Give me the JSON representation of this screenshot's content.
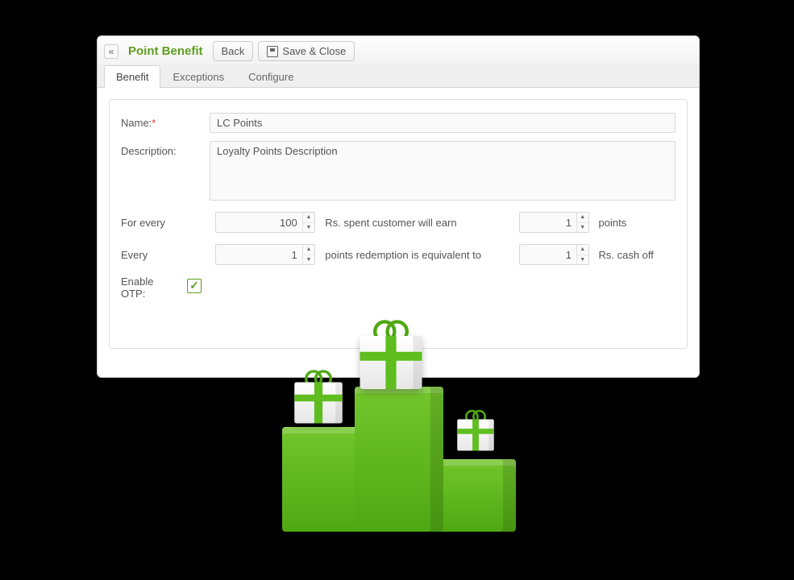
{
  "header": {
    "title": "Point Benefit",
    "back_label": "Back",
    "save_label": "Save & Close"
  },
  "tabs": {
    "benefit": "Benefit",
    "exceptions": "Exceptions",
    "configure": "Configure"
  },
  "form": {
    "name_label": "Name:",
    "name_value": "LC Points",
    "description_label": "Description:",
    "description_value": "Loyalty Points Description",
    "rule1": {
      "for_every": "For every",
      "amount": "100",
      "middle": "Rs. spent customer will earn",
      "earn": "1",
      "end": "points"
    },
    "rule2": {
      "every": "Every",
      "points": "1",
      "middle": "points redemption is equivalent to",
      "cash": "1",
      "end": "Rs. cash off"
    },
    "enable_otp_label": "Enable OTP:",
    "enable_otp_checked": true
  }
}
